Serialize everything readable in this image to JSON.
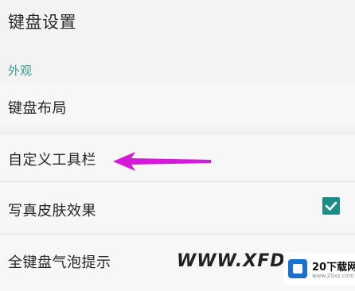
{
  "header": {
    "title": "键盘设置"
  },
  "sections": [
    {
      "header": "外观",
      "items": [
        {
          "label": "键盘布局"
        },
        {
          "label": "自定义工具栏"
        },
        {
          "label": "写真皮肤效果",
          "checked": true
        },
        {
          "label": "全键盘气泡提示"
        }
      ]
    }
  ],
  "annotation": {
    "arrow_color": "#d21ad8"
  },
  "watermark": {
    "text": "WWW.XFDOW",
    "logo_main": "20下载网",
    "logo_sub": "www.20xz.com"
  },
  "colors": {
    "accent": "#3aa08f",
    "checkbox": "#1f8d86",
    "background": "#f3f3f3"
  }
}
